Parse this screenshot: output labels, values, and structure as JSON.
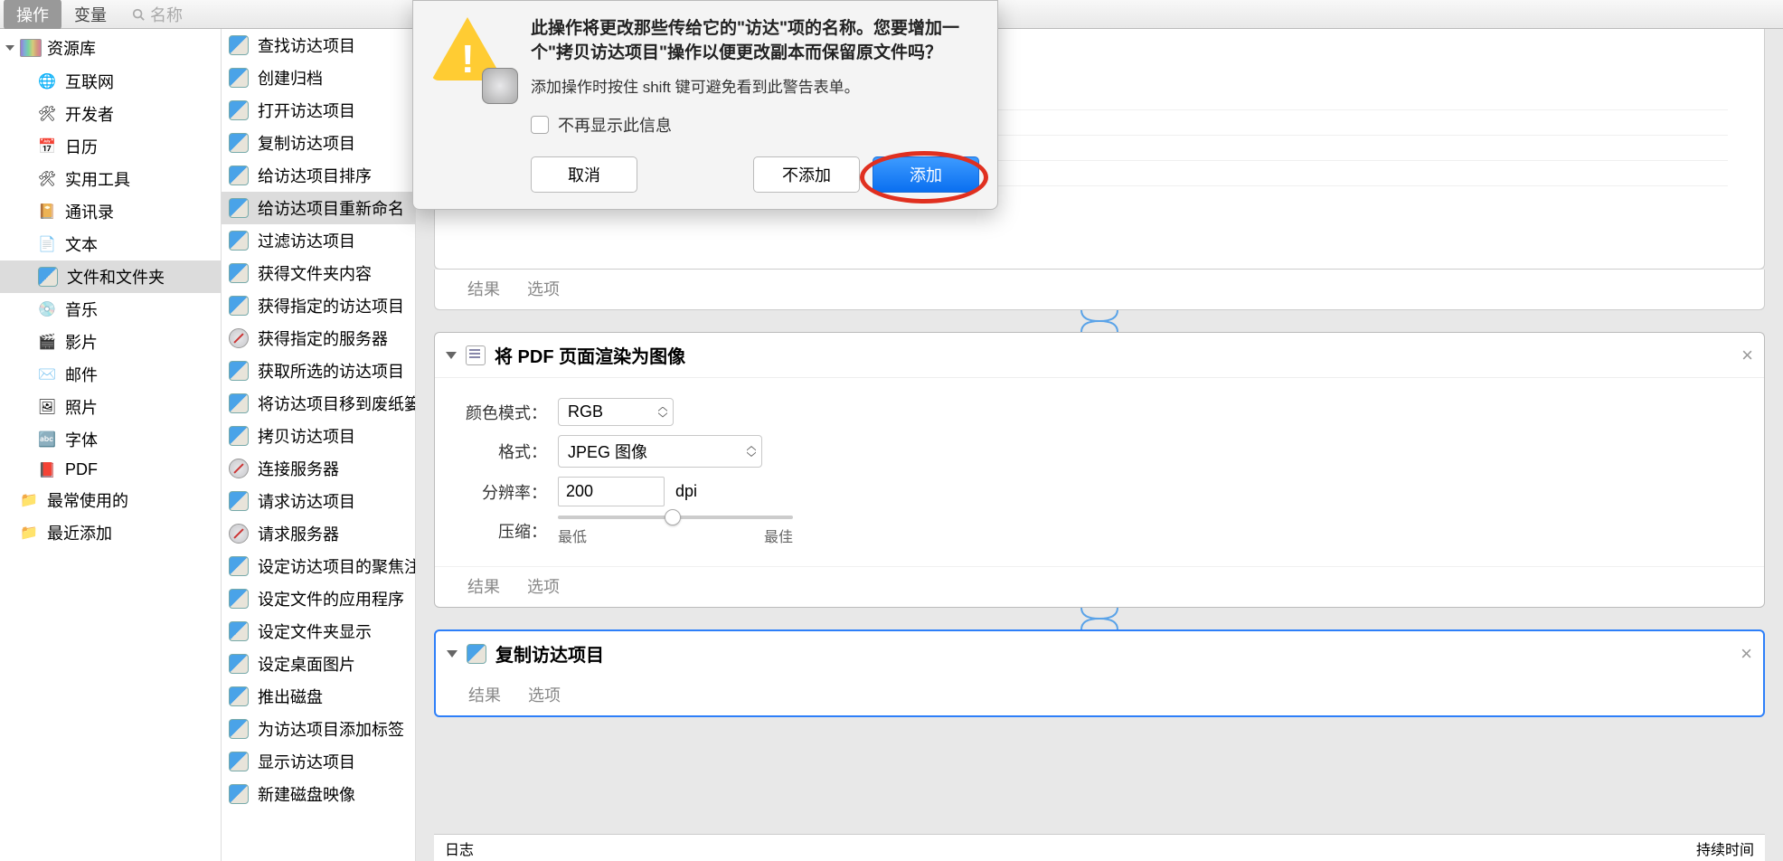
{
  "tabs": {
    "actions": "操作",
    "variables": "变量",
    "search_placeholder": "名称"
  },
  "sidebar": {
    "library": "资源库",
    "items": [
      {
        "label": "互联网",
        "emoji": "🌐"
      },
      {
        "label": "开发者",
        "emoji": "🛠"
      },
      {
        "label": "日历",
        "emoji": "📅"
      },
      {
        "label": "实用工具",
        "emoji": "🛠"
      },
      {
        "label": "通讯录",
        "emoji": "📔"
      },
      {
        "label": "文本",
        "emoji": "📄"
      },
      {
        "label": "文件和文件夹",
        "emoji": "",
        "selected": true,
        "finder": true
      },
      {
        "label": "音乐",
        "emoji": "💿"
      },
      {
        "label": "影片",
        "emoji": "🎬"
      },
      {
        "label": "邮件",
        "emoji": "✉️"
      },
      {
        "label": "照片",
        "emoji": "🖼"
      },
      {
        "label": "字体",
        "emoji": "🔤"
      },
      {
        "label": "PDF",
        "emoji": "📕"
      }
    ],
    "groups": [
      {
        "label": "最常使用的"
      },
      {
        "label": "最近添加"
      }
    ]
  },
  "actions": [
    {
      "label": "查找访达项目",
      "kind": "finder"
    },
    {
      "label": "创建归档",
      "kind": "finder"
    },
    {
      "label": "打开访达项目",
      "kind": "finder"
    },
    {
      "label": "复制访达项目",
      "kind": "finder"
    },
    {
      "label": "给访达项目排序",
      "kind": "finder"
    },
    {
      "label": "给访达项目重新命名",
      "kind": "finder",
      "highlight": true
    },
    {
      "label": "过滤访达项目",
      "kind": "finder"
    },
    {
      "label": "获得文件夹内容",
      "kind": "finder"
    },
    {
      "label": "获得指定的访达项目",
      "kind": "finder"
    },
    {
      "label": "获得指定的服务器",
      "kind": "safari"
    },
    {
      "label": "获取所选的访达项目",
      "kind": "finder"
    },
    {
      "label": "将访达项目移到废纸篓",
      "kind": "finder"
    },
    {
      "label": "拷贝访达项目",
      "kind": "finder"
    },
    {
      "label": "连接服务器",
      "kind": "safari"
    },
    {
      "label": "请求访达项目",
      "kind": "finder"
    },
    {
      "label": "请求服务器",
      "kind": "safari"
    },
    {
      "label": "设定访达项目的聚焦注释",
      "kind": "finder"
    },
    {
      "label": "设定文件的应用程序",
      "kind": "finder"
    },
    {
      "label": "设定文件夹显示",
      "kind": "finder"
    },
    {
      "label": "设定桌面图片",
      "kind": "finder"
    },
    {
      "label": "推出磁盘",
      "kind": "finder"
    },
    {
      "label": "为访达项目添加标签",
      "kind": "finder"
    },
    {
      "label": "显示访达项目",
      "kind": "finder"
    },
    {
      "label": "新建磁盘映像",
      "kind": "finder"
    }
  ],
  "dialog": {
    "message": "此操作将更改那些传给它的\"访达\"项的名称。您要增加一个\"拷贝访达项目\"操作以便更改副本而保留原文件吗？",
    "hint": "添加操作时按住 shift 键可避免看到此警告表单。",
    "checkbox": "不再显示此信息",
    "cancel": "取消",
    "dont_add": "不添加",
    "add": "添加"
  },
  "workflow": {
    "card_footer_results": "结果",
    "card_footer_options": "选项",
    "pdf_card": {
      "title": "将 PDF 页面渲染为图像",
      "color_mode_label": "颜色模式：",
      "color_mode_value": "RGB",
      "format_label": "格式：",
      "format_value": "JPEG 图像",
      "resolution_label": "分辨率：",
      "resolution_value": "200",
      "resolution_unit": "dpi",
      "compression_label": "压缩：",
      "compression_low": "最低",
      "compression_high": "最佳"
    },
    "copy_card": {
      "title": "复制访达项目"
    },
    "log": {
      "col1": "日志",
      "col2": "持续时间"
    }
  }
}
